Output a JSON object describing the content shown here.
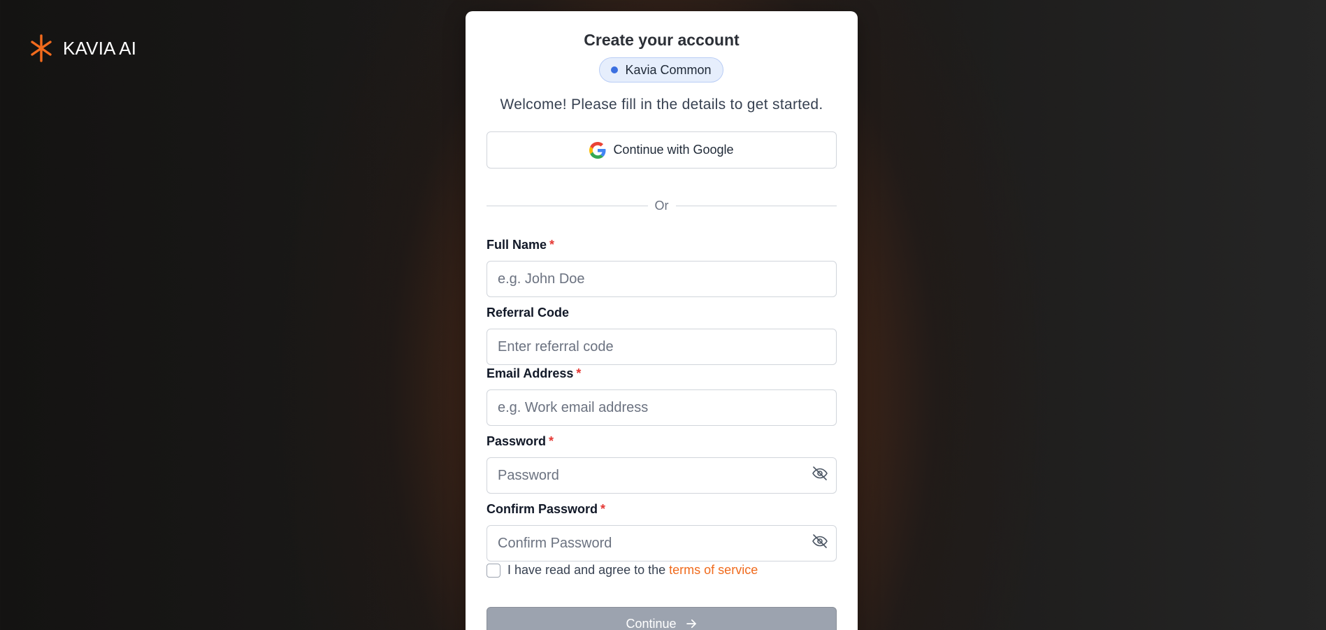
{
  "brand": {
    "name": "KAVIA AI",
    "logo_icon": "asterisk-logo-icon",
    "logo_color": "#F26B1D"
  },
  "signup": {
    "title": "Create your account",
    "badge": {
      "label": "Kavia Common",
      "dot_color": "#3B6FE0"
    },
    "subtitle": "Welcome! Please fill in the details to get started.",
    "google_button": {
      "label": "Continue with Google",
      "icon": "google-g-icon"
    },
    "divider_text": "Or",
    "fields": {
      "full_name": {
        "label": "Full Name",
        "required_mark": "*",
        "placeholder": "e.g. John Doe",
        "value": ""
      },
      "referral_code": {
        "label": "Referral Code",
        "placeholder": "Enter referral code",
        "value": ""
      },
      "email": {
        "label": "Email Address",
        "required_mark": "*",
        "placeholder": "e.g. Work email address",
        "value": ""
      },
      "password": {
        "label": "Password",
        "required_mark": "*",
        "placeholder": "Password",
        "value": "",
        "toggle_icon": "eye-off-icon"
      },
      "confirm_password": {
        "label": "Confirm Password",
        "required_mark": "*",
        "placeholder": "Confirm Password",
        "value": "",
        "toggle_icon": "eye-off-icon"
      }
    },
    "terms": {
      "text": "I have read and agree to the",
      "link_text": "terms of service",
      "link_color": "#F06A1C",
      "checked": false
    },
    "continue_button": {
      "label": "Continue",
      "icon": "arrow-right-icon",
      "state": "disabled"
    }
  },
  "colors": {
    "accent": "#F26B1D",
    "required": "#E53935",
    "button_disabled": "#9CA3AF"
  }
}
